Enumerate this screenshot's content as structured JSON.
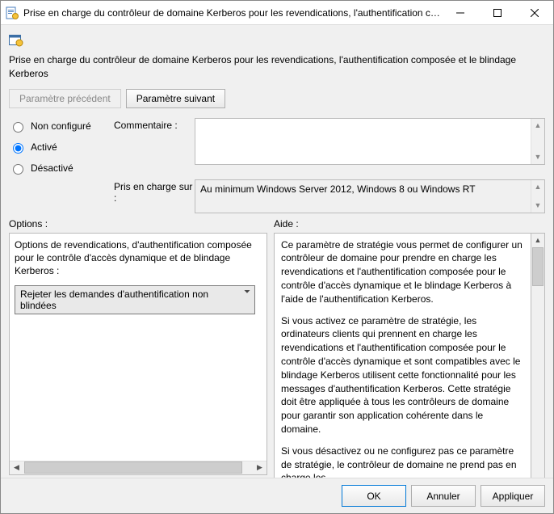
{
  "window": {
    "title": "Prise en charge du contrôleur de domaine Kerberos pour les revendications, l'authentification co..."
  },
  "policy": {
    "full_title": "Prise en charge du contrôleur de domaine Kerberos pour les revendications, l'authentification composée et le blindage Kerberos"
  },
  "nav": {
    "prev": "Paramètre précédent",
    "next": "Paramètre suivant"
  },
  "state": {
    "not_configured": "Non configuré",
    "enabled": "Activé",
    "disabled": "Désactivé",
    "selected": "enabled"
  },
  "labels": {
    "comment": "Commentaire :",
    "supported": "Pris en charge sur :",
    "options": "Options :",
    "help": "Aide :"
  },
  "comment_value": "",
  "supported_value": "Au minimum Windows Server 2012, Windows 8 ou Windows RT",
  "options": {
    "heading": "Options de revendications, d'authentification composée pour le contrôle d'accès dynamique et de blindage Kerberos :",
    "dropdown_selected": "Rejeter les demandes d'authentification non blindées"
  },
  "help": {
    "p1": "Ce paramètre de stratégie vous permet de configurer un contrôleur de domaine pour prendre en charge les revendications et l'authentification composée pour le contrôle d'accès dynamique et le blindage Kerberos à l'aide de l'authentification Kerberos.",
    "p2": "Si vous activez ce paramètre de stratégie, les ordinateurs clients qui prennent en charge les revendications et l'authentification composée pour le contrôle d'accès dynamique et sont compatibles avec le blindage Kerberos utilisent cette fonctionnalité pour les messages d'authentification Kerberos. Cette stratégie doit être appliquée à tous les contrôleurs de domaine pour garantir son application cohérente dans le domaine.",
    "p3": "Si vous désactivez ou ne configurez pas ce paramètre de stratégie, le contrôleur de domaine ne prend pas en charge les"
  },
  "footer": {
    "ok": "OK",
    "cancel": "Annuler",
    "apply": "Appliquer"
  }
}
